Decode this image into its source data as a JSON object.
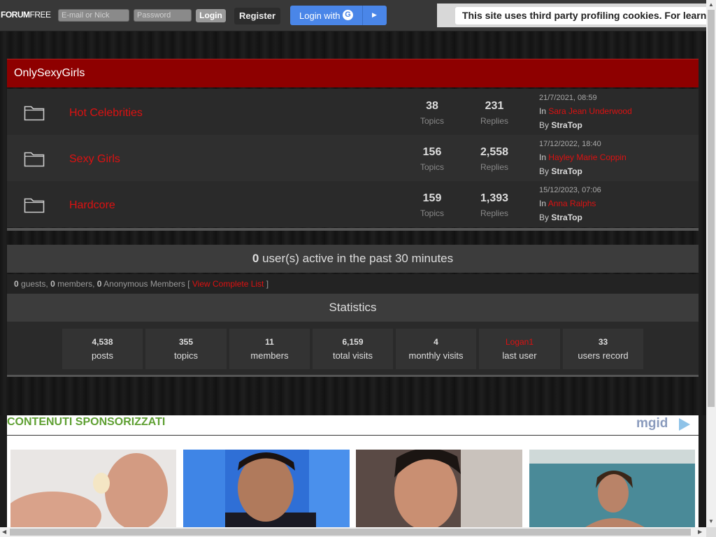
{
  "topbar": {
    "logo": {
      "bold": "FORUM",
      "rest": "FREE"
    },
    "email_placeholder": "E-mail or Nick",
    "password_placeholder": "Password",
    "login_label": "Login",
    "register_label": "Register",
    "google_label": "Login with",
    "google_glyph": "G"
  },
  "cookie_notice": "This site uses third party profiling cookies. For learning",
  "category": {
    "title": "OnlySexyGirls",
    "forums": [
      {
        "name": "Hot Celebrities",
        "topics": "38",
        "replies": "231",
        "date": "21/7/2021, 08:59",
        "in_label": "In",
        "last_topic": "Sara Jean Underwood",
        "by_label": "By",
        "last_user": "StraTop"
      },
      {
        "name": "Sexy Girls",
        "topics": "156",
        "replies": "2,558",
        "date": "17/12/2022, 18:40",
        "in_label": "In",
        "last_topic": "Hayley Marie Coppin",
        "by_label": "By",
        "last_user": "StraTop"
      },
      {
        "name": "Hardcore",
        "topics": "159",
        "replies": "1,393",
        "date": "15/12/2023, 07:06",
        "in_label": "In",
        "last_topic": "Anna Ralphs",
        "by_label": "By",
        "last_user": "StraTop"
      }
    ],
    "topics_label": "Topics",
    "replies_label": "Replies"
  },
  "active": {
    "count": "0",
    "text": "user(s) active in the past 30 minutes",
    "guests": "0",
    "guests_label": "guests,",
    "members": "0",
    "members_label": "members,",
    "anon": "0",
    "anon_label": "Anonymous Members [",
    "link": "View Complete List",
    "close": "]"
  },
  "statistics": {
    "title": "Statistics",
    "items": [
      {
        "value": "4,538",
        "label": "posts"
      },
      {
        "value": "355",
        "label": "topics"
      },
      {
        "value": "11",
        "label": "members"
      },
      {
        "value": "6,159",
        "label": "total visits"
      },
      {
        "value": "4",
        "label": "monthly visits"
      },
      {
        "value": "Logan1",
        "label": "last user"
      },
      {
        "value": "33",
        "label": "users record"
      }
    ]
  },
  "sponsored": {
    "title": "CONTENUTI SPONSORIZZATI",
    "brand": "mgid"
  },
  "colors": {
    "accent_red": "#dd1111",
    "header_red": "#8e0000",
    "google_blue": "#4a86e8",
    "sponsor_green": "#5fa033"
  }
}
